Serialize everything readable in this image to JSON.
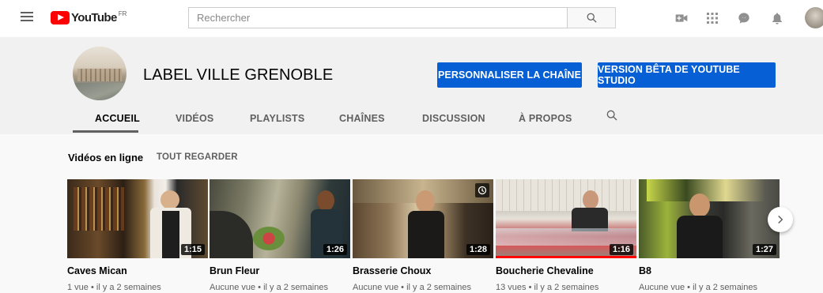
{
  "masthead": {
    "logo_text": "YouTube",
    "country_code": "FR",
    "search_placeholder": "Rechercher",
    "icons": [
      "menu-icon",
      "search-icon",
      "create-video-icon",
      "apps-icon",
      "messages-icon",
      "notifications-icon",
      "account-avatar"
    ]
  },
  "channel": {
    "name": "LABEL VILLE GRENOBLE",
    "customize_label": "PERSONNALISER LA CHAÎNE",
    "studio_label": "VERSION BÊTA DE YOUTUBE STUDIO",
    "accent_color": "#065fd4"
  },
  "tabs": [
    {
      "label": "ACCUEIL",
      "active": true
    },
    {
      "label": "VIDÉOS",
      "active": false
    },
    {
      "label": "PLAYLISTS",
      "active": false
    },
    {
      "label": "CHAÎNES",
      "active": false
    },
    {
      "label": "DISCUSSION",
      "active": false
    },
    {
      "label": "À PROPOS",
      "active": false
    }
  ],
  "shelf": {
    "title": "Vidéos en ligne",
    "link": "TOUT REGARDER",
    "videos": [
      {
        "title": "Caves Mican",
        "meta": "1 vue • il y a 2 semaines",
        "duration": "1:15"
      },
      {
        "title": "Brun Fleur",
        "meta": "Aucune vue • il y a 2 semaines",
        "duration": "1:26"
      },
      {
        "title": "Brasserie Choux",
        "meta": "Aucune vue • il y a 2 semaines",
        "duration": "1:28"
      },
      {
        "title": "Boucherie Chevaline",
        "meta": "13 vues • il y a 2 semaines",
        "duration": "1:16",
        "watched_fraction": 1.0
      },
      {
        "title": "B8",
        "meta": "Aucune vue • il y a 2 semaines",
        "duration": "1:27"
      }
    ]
  }
}
